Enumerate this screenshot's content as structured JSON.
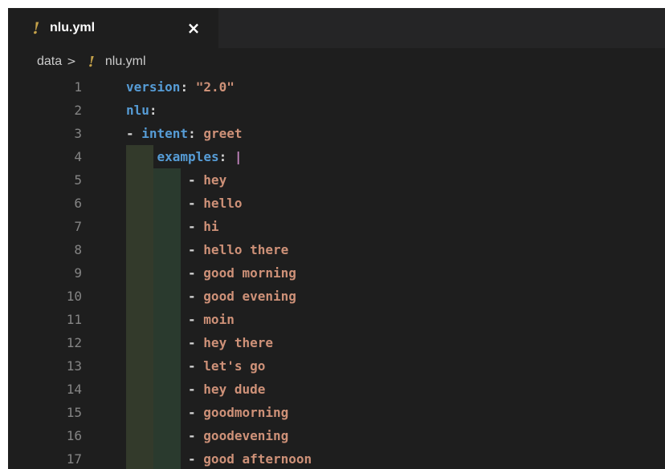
{
  "tab": {
    "title": "nlu.yml",
    "icon": "yaml-exclamation-icon",
    "close_label": "×"
  },
  "breadcrumb": {
    "folder": "data",
    "separator": ">",
    "file": "nlu.yml"
  },
  "colors": {
    "editor_bg": "#1e1e1e",
    "key": "#569cd6",
    "string": "#ce9178",
    "line_number": "#858585",
    "pipe": "#c586c0",
    "yaml_icon": "#c5a24a"
  },
  "code": {
    "lines": [
      {
        "num": "1",
        "key": "version",
        "sep": ": ",
        "value": "\"2.0\""
      },
      {
        "num": "2",
        "key": "nlu",
        "sep": ":"
      },
      {
        "num": "3",
        "dash": "- ",
        "key": "intent",
        "sep": ": ",
        "value": "greet"
      },
      {
        "num": "4",
        "key": "examples",
        "sep": ": ",
        "pipe": "|"
      },
      {
        "num": "5",
        "dash": "- ",
        "value": "hey"
      },
      {
        "num": "6",
        "dash": "- ",
        "value": "hello"
      },
      {
        "num": "7",
        "dash": "- ",
        "value": "hi"
      },
      {
        "num": "8",
        "dash": "- ",
        "value": "hello there"
      },
      {
        "num": "9",
        "dash": "- ",
        "value": "good morning"
      },
      {
        "num": "10",
        "dash": "- ",
        "value": "good evening"
      },
      {
        "num": "11",
        "dash": "- ",
        "value": "moin"
      },
      {
        "num": "12",
        "dash": "- ",
        "value": "hey there"
      },
      {
        "num": "13",
        "dash": "- ",
        "value": "let's go"
      },
      {
        "num": "14",
        "dash": "- ",
        "value": "hey dude"
      },
      {
        "num": "15",
        "dash": "- ",
        "value": "goodmorning"
      },
      {
        "num": "16",
        "dash": "- ",
        "value": "goodevening"
      },
      {
        "num": "17",
        "dash": "- ",
        "value": "good afternoon"
      }
    ]
  }
}
